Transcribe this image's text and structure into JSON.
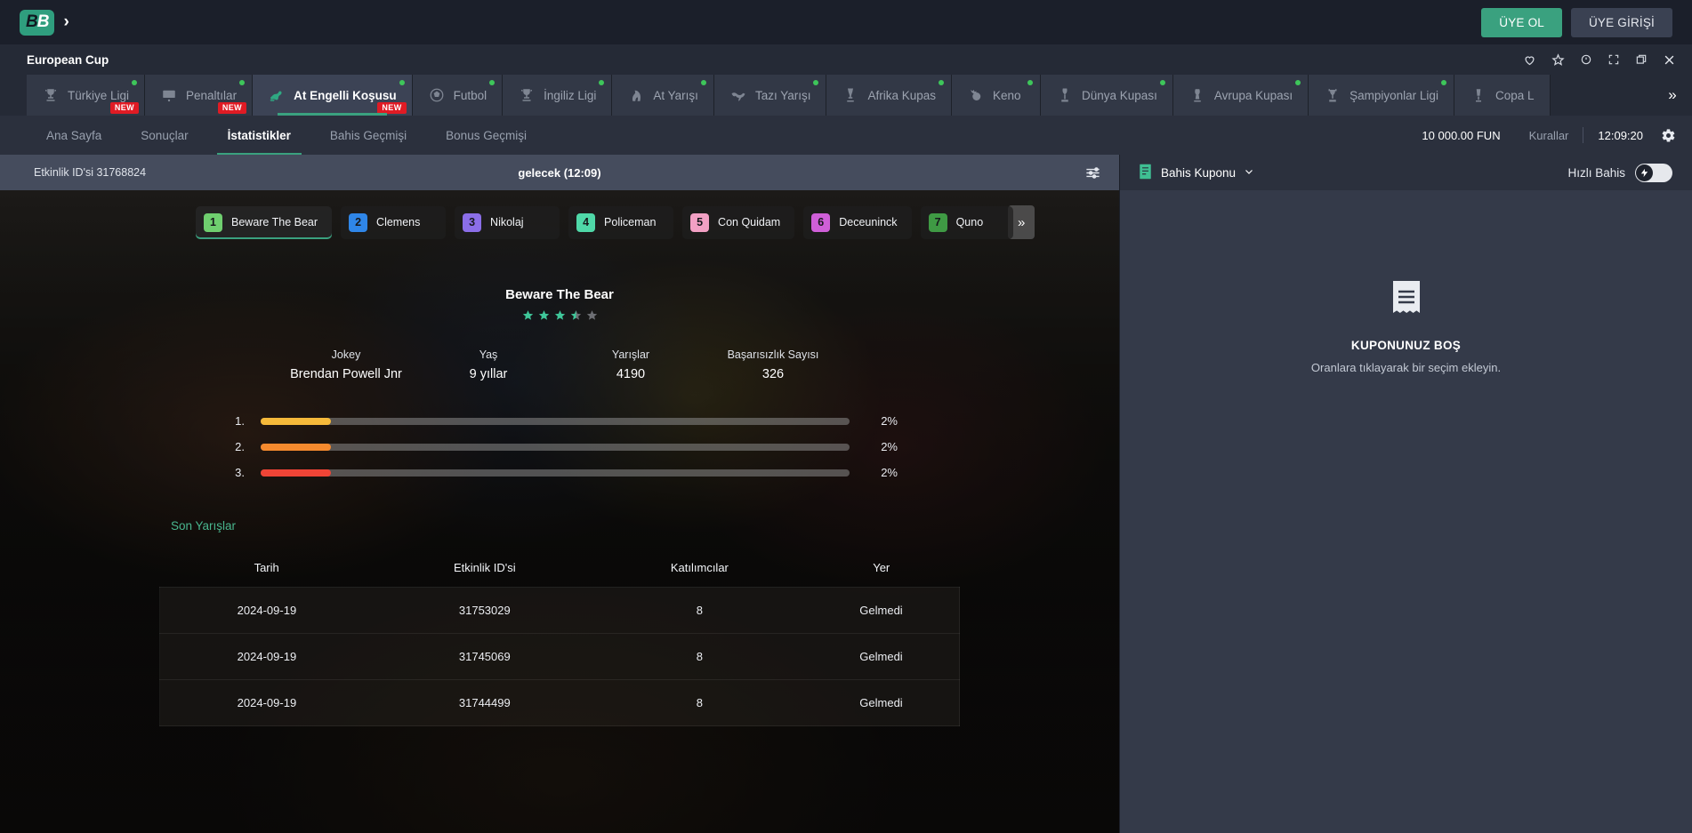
{
  "brand": {
    "logo_b1": "B",
    "logo_b2": "B",
    "chevron": "›",
    "accent": "#3aa17f"
  },
  "topbar": {
    "signup_label": "ÜYE OL",
    "login_label": "ÜYE GİRİŞİ"
  },
  "window": {
    "title": "European Cup",
    "icons": [
      "heart-icon",
      "star-icon",
      "clock-icon",
      "fullscreen-icon",
      "popout-icon",
      "close-icon"
    ]
  },
  "sport_tabs": [
    {
      "label": "Türkiye Ligi",
      "icon": "trophy-icon",
      "new": true,
      "live": true,
      "active": false
    },
    {
      "label": "Penaltılar",
      "icon": "goal-icon",
      "new": true,
      "live": true,
      "active": false
    },
    {
      "label": "At Engelli Koşusu",
      "icon": "horse-jump-icon",
      "new": true,
      "live": true,
      "active": true
    },
    {
      "label": "Futbol",
      "icon": "football-icon",
      "new": false,
      "live": true,
      "active": false
    },
    {
      "label": "İngiliz Ligi",
      "icon": "trophy-icon",
      "new": false,
      "live": true,
      "active": false
    },
    {
      "label": "At Yarışı",
      "icon": "horse-head-icon",
      "new": false,
      "live": true,
      "active": false
    },
    {
      "label": "Tazı Yarışı",
      "icon": "greyhound-icon",
      "new": false,
      "live": true,
      "active": false
    },
    {
      "label": "Afrika Kupas",
      "icon": "africa-cup-icon",
      "new": false,
      "live": true,
      "active": false
    },
    {
      "label": "Keno",
      "icon": "keno-icon",
      "new": false,
      "live": true,
      "active": false
    },
    {
      "label": "Dünya Kupası",
      "icon": "world-cup-icon",
      "new": false,
      "live": true,
      "active": false
    },
    {
      "label": "Avrupa Kupası",
      "icon": "euro-cup-icon",
      "new": false,
      "live": true,
      "active": false
    },
    {
      "label": "Şampiyonlar Ligi",
      "icon": "champions-cup-icon",
      "new": false,
      "live": true,
      "active": false
    },
    {
      "label": "Copa L",
      "icon": "copa-icon",
      "new": false,
      "live": false,
      "active": false
    }
  ],
  "sub_nav": {
    "items": [
      {
        "label": "Ana Sayfa",
        "active": false
      },
      {
        "label": "Sonuçlar",
        "active": false
      },
      {
        "label": "İstatistikler",
        "active": true
      },
      {
        "label": "Bahis Geçmişi",
        "active": false
      },
      {
        "label": "Bonus Geçmişi",
        "active": false
      }
    ],
    "balance": "10 000.00 FUN",
    "rules_label": "Kurallar",
    "clock": "12:09:20"
  },
  "event": {
    "id_label": "Etkinlik ID'si 31768824",
    "status": "gelecek (12:09)"
  },
  "runners": [
    {
      "num": "1",
      "name": "Beware The Bear",
      "color": "#6fcf6f",
      "active": true
    },
    {
      "num": "2",
      "name": "Clemens",
      "color": "#2f86e8",
      "active": false
    },
    {
      "num": "3",
      "name": "Nikolaj",
      "color": "#8b6ee8",
      "active": false
    },
    {
      "num": "4",
      "name": "Policeman",
      "color": "#4fd8a8",
      "active": false
    },
    {
      "num": "5",
      "name": "Con Quidam",
      "color": "#f2a0c4",
      "active": false
    },
    {
      "num": "6",
      "name": "Deceuninck",
      "color": "#cf5fd8",
      "active": false
    },
    {
      "num": "7",
      "name": "Quno",
      "color": "#3f9a44",
      "active": false
    }
  ],
  "runners_more_label": "»",
  "horse": {
    "name": "Beware The Bear",
    "rating": 3.5,
    "rating_max": 5,
    "stats": [
      {
        "key": "Jokey",
        "value": "Brendan Powell Jnr"
      },
      {
        "key": "Yaş",
        "value": "9 yıllar"
      },
      {
        "key": "Yarışlar",
        "value": "4190"
      },
      {
        "key": "Başarısızlık Sayısı",
        "value": "326"
      }
    ],
    "placements": [
      {
        "rank": "1.",
        "pct_label": "2%",
        "pct": 2,
        "color": "#f5b93a"
      },
      {
        "rank": "2.",
        "pct_label": "2%",
        "pct": 2,
        "color": "#f58a2e"
      },
      {
        "rank": "3.",
        "pct_label": "2%",
        "pct": 2,
        "color": "#ef4436"
      }
    ]
  },
  "recent_races": {
    "title": "Son Yarışlar",
    "columns": [
      "Tarih",
      "Etkinlik ID'si",
      "Katılımcılar",
      "Yer"
    ],
    "rows": [
      [
        "2024-09-19",
        "31753029",
        "8",
        "Gelmedi"
      ],
      [
        "2024-09-19",
        "31745069",
        "8",
        "Gelmedi"
      ],
      [
        "2024-09-19",
        "31744499",
        "8",
        "Gelmedi"
      ]
    ]
  },
  "betslip": {
    "title": "Bahis Kuponu",
    "fastbet_label": "Hızlı Bahis",
    "fastbet_on": false,
    "empty_title": "KUPONUNUZ BOŞ",
    "empty_sub": "Oranlara tıklayarak bir seçim ekleyin."
  }
}
